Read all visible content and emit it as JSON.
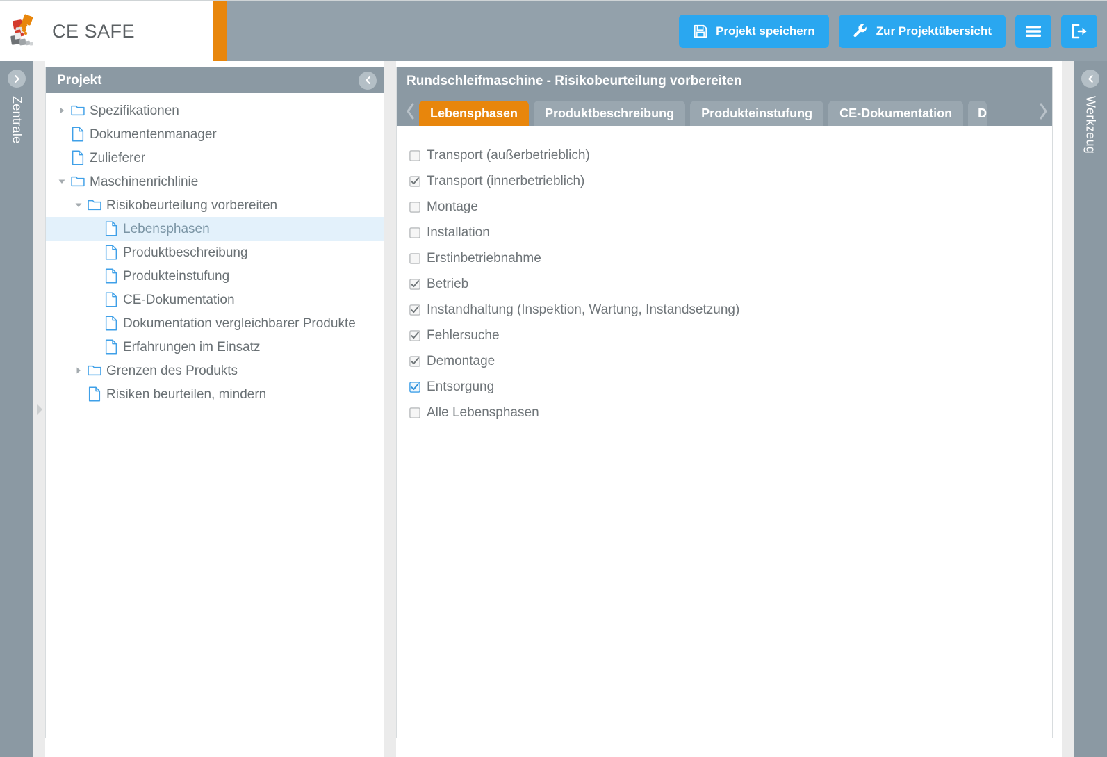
{
  "app": {
    "brand": "CE SAFE",
    "brand_accent_color": "#E8860C",
    "button_color": "#2aa7f0"
  },
  "topbar": {
    "save_label": "Projekt speichern",
    "save_icon": "floppy-disk-icon",
    "overview_label": "Zur Projektübersicht",
    "overview_icon": "wrench-icon",
    "menu_icon": "hamburger-menu-icon",
    "logout_icon": "sign-out-icon"
  },
  "rails": {
    "left": {
      "label": "Zentrale",
      "toggle_icon": "chevron-right-circle-icon"
    },
    "right": {
      "label": "Werkzeug",
      "toggle_icon": "chevron-left-circle-icon"
    }
  },
  "project_panel": {
    "title": "Projekt",
    "collapse_icon": "chevron-left-circle-icon",
    "tree": [
      {
        "label": "Spezifikationen",
        "icon": "folder-icon",
        "toggle": "collapsed",
        "depth": 0,
        "selected": false
      },
      {
        "label": "Dokumentenmanager",
        "icon": "file-icon",
        "toggle": "none",
        "depth": 0,
        "selected": false
      },
      {
        "label": "Zulieferer",
        "icon": "file-icon",
        "toggle": "none",
        "depth": 0,
        "selected": false
      },
      {
        "label": "Maschinenrichlinie",
        "icon": "folder-icon",
        "toggle": "expanded",
        "depth": 0,
        "selected": false
      },
      {
        "label": "Risikobeurteilung vorbereiten",
        "icon": "folder-icon",
        "toggle": "expanded",
        "depth": 1,
        "selected": false
      },
      {
        "label": "Lebensphasen",
        "icon": "file-icon",
        "toggle": "none",
        "depth": 2,
        "selected": true
      },
      {
        "label": "Produktbeschreibung",
        "icon": "file-icon",
        "toggle": "none",
        "depth": 2,
        "selected": false
      },
      {
        "label": "Produkteinstufung",
        "icon": "file-icon",
        "toggle": "none",
        "depth": 2,
        "selected": false
      },
      {
        "label": "CE-Dokumentation",
        "icon": "file-icon",
        "toggle": "none",
        "depth": 2,
        "selected": false
      },
      {
        "label": "Dokumentation vergleichbarer Produkte",
        "icon": "file-icon",
        "toggle": "none",
        "depth": 2,
        "selected": false
      },
      {
        "label": "Erfahrungen im Einsatz",
        "icon": "file-icon",
        "toggle": "none",
        "depth": 2,
        "selected": false
      },
      {
        "label": "Grenzen des Produkts",
        "icon": "folder-icon",
        "toggle": "collapsed",
        "depth": 1,
        "selected": false
      },
      {
        "label": "Risiken beurteilen, mindern",
        "icon": "file-icon",
        "toggle": "none",
        "depth": 1,
        "selected": false
      }
    ]
  },
  "content": {
    "title": "Rundschleifmaschine - Risikobeurteilung vorbereiten",
    "prev_tab_icon": "chevron-left-icon",
    "next_tab_icon": "chevron-right-icon",
    "tabs": [
      {
        "label": "Lebensphasen",
        "active": true,
        "clipped": false
      },
      {
        "label": "Produktbeschreibung",
        "active": false,
        "clipped": false
      },
      {
        "label": "Produkteinstufung",
        "active": false,
        "clipped": false
      },
      {
        "label": "CE-Dokumentation",
        "active": false,
        "clipped": false
      },
      {
        "label": "D",
        "active": false,
        "clipped": true
      }
    ],
    "lifecycle_phases": [
      {
        "label": "Transport (außerbetrieblich)",
        "checked": false,
        "focused": false
      },
      {
        "label": "Transport (innerbetrieblich)",
        "checked": true,
        "focused": false
      },
      {
        "label": "Montage",
        "checked": false,
        "focused": false
      },
      {
        "label": "Installation",
        "checked": false,
        "focused": false
      },
      {
        "label": "Erstinbetriebnahme",
        "checked": false,
        "focused": false
      },
      {
        "label": "Betrieb",
        "checked": true,
        "focused": false
      },
      {
        "label": "Instandhaltung (Inspektion, Wartung, Instandsetzung)",
        "checked": true,
        "focused": false
      },
      {
        "label": "Fehlersuche",
        "checked": true,
        "focused": false
      },
      {
        "label": "Demontage",
        "checked": true,
        "focused": false
      },
      {
        "label": "Entsorgung",
        "checked": true,
        "focused": true
      },
      {
        "label": "Alle Lebensphasen",
        "checked": false,
        "focused": false
      }
    ]
  }
}
